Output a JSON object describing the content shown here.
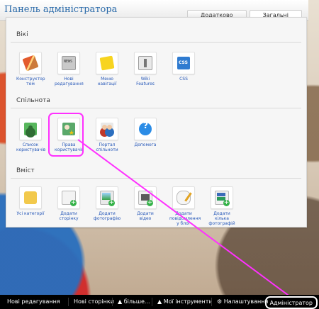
{
  "panel": {
    "title": "Панель адміністратора",
    "tabs": [
      {
        "label": "Додатково",
        "active": false
      },
      {
        "label": "Загальні",
        "active": true
      }
    ]
  },
  "sections": {
    "wiki": {
      "title": "Вікі",
      "items": [
        {
          "label": "Конструктор тем",
          "icon": "tools-icon"
        },
        {
          "label": "Нові редагування",
          "icon": "news-icon"
        },
        {
          "label": "Меню навігації",
          "icon": "sticky-note-icon"
        },
        {
          "label": "Wiki Features",
          "icon": "wiki-features-icon"
        },
        {
          "label": "CSS",
          "icon": "css-icon"
        }
      ]
    },
    "community": {
      "title": "Спільнота",
      "items": [
        {
          "label": "Список користувачів",
          "icon": "users-list-icon"
        },
        {
          "label": "Права користувачів",
          "icon": "user-rights-icon"
        },
        {
          "label": "Портал спільноти",
          "icon": "community-portal-icon"
        },
        {
          "label": "Допомога",
          "icon": "help-icon"
        }
      ]
    },
    "content": {
      "title": "Вміст",
      "items": [
        {
          "label": "Усі категорії",
          "icon": "folder-icon"
        },
        {
          "label": "Додати сторінку",
          "icon": "add-page-icon"
        },
        {
          "label": "Додати фотографію",
          "icon": "add-photo-icon"
        },
        {
          "label": "Додати відео",
          "icon": "add-video-icon"
        },
        {
          "label": "Додати повідомлення у блог",
          "icon": "add-blog-post-icon"
        },
        {
          "label": "Додати кілька фотографій",
          "icon": "add-multiple-photos-icon"
        }
      ]
    }
  },
  "bottom_bar": {
    "items": [
      {
        "label": "Нові редагування"
      },
      {
        "label": "Нові сторінки"
      },
      {
        "label": "більше...",
        "icon": "arrow-up-icon"
      },
      {
        "label": "Мої інструменти",
        "icon": "arrow-up-icon"
      },
      {
        "label": "Налаштування",
        "icon": "gear-icon"
      },
      {
        "label": "Адміністратор"
      }
    ]
  },
  "colors": {
    "title_blue": "#2a6aa9",
    "link_blue": "#2557b8",
    "highlight_magenta": "#ff30ff",
    "bottom_bar_black": "#000000"
  }
}
